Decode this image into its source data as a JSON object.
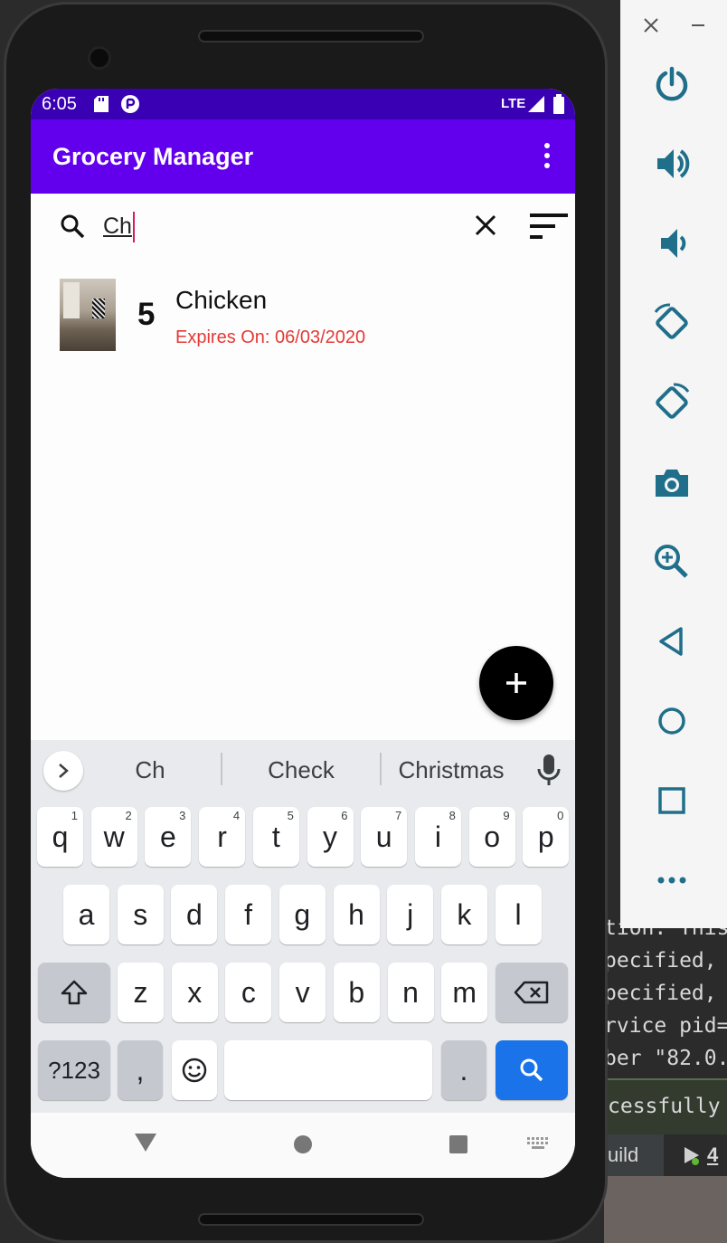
{
  "statusbar": {
    "time": "6:05",
    "network": "LTE"
  },
  "appbar": {
    "title": "Grocery Manager",
    "overflow_icon": "more-vert-icon"
  },
  "search": {
    "value": "Ch",
    "clear_icon": "close-icon",
    "sort_icon": "sort-icon"
  },
  "items": [
    {
      "quantity": "5",
      "name": "Chicken",
      "expiry": "Expires On: 06/03/2020"
    }
  ],
  "fab": {
    "icon": "plus-icon"
  },
  "keyboard": {
    "suggestions": [
      "Ch",
      "Check",
      "Christmas"
    ],
    "row1": [
      {
        "k": "q",
        "h": "1"
      },
      {
        "k": "w",
        "h": "2"
      },
      {
        "k": "e",
        "h": "3"
      },
      {
        "k": "r",
        "h": "4"
      },
      {
        "k": "t",
        "h": "5"
      },
      {
        "k": "y",
        "h": "6"
      },
      {
        "k": "u",
        "h": "7"
      },
      {
        "k": "i",
        "h": "8"
      },
      {
        "k": "o",
        "h": "9"
      },
      {
        "k": "p",
        "h": "0"
      }
    ],
    "row2": [
      "a",
      "s",
      "d",
      "f",
      "g",
      "h",
      "j",
      "k",
      "l"
    ],
    "row3": [
      "z",
      "x",
      "c",
      "v",
      "b",
      "n",
      "m"
    ],
    "symbols_label": "?123",
    "comma_label": ",",
    "period_label": "."
  },
  "ide": {
    "console_lines": [
      "tion. This",
      "pecified,",
      "pecified,",
      "rvice pid=",
      "ber \"82.0."
    ],
    "success_text": "cessfully f",
    "tab_label": "uild",
    "run_label": "4"
  },
  "colors": {
    "status_bar": "#3a00b4",
    "app_bar": "#6200ee",
    "expiry": "#e53935",
    "search_key": "#1a73e8"
  }
}
